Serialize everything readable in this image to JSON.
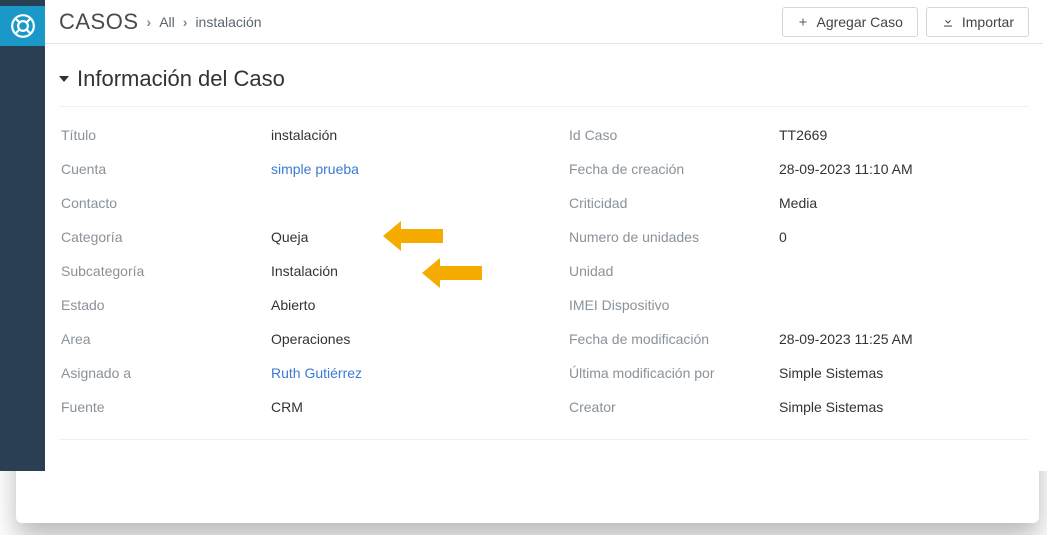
{
  "breadcrumb": {
    "module": "CASOS",
    "all": "All",
    "current": "instalación"
  },
  "header": {
    "add_case": "Agregar Caso",
    "import": "Importar"
  },
  "panel": {
    "title": "Información del Caso"
  },
  "left": {
    "titulo_label": "Título",
    "titulo": "instalación",
    "cuenta_label": "Cuenta",
    "cuenta": "simple prueba",
    "contacto_label": "Contacto",
    "contacto": "",
    "categoria_label": "Categoría",
    "categoria": "Queja",
    "subcategoria_label": "Subcategoría",
    "subcategoria": "Instalación",
    "estado_label": "Estado",
    "estado": "Abierto",
    "area_label": "Area",
    "area": "Operaciones",
    "asignado_label": "Asignado a",
    "asignado": "Ruth Gutiérrez",
    "fuente_label": "Fuente",
    "fuente": "CRM"
  },
  "right": {
    "idcaso_label": "Id Caso",
    "idcaso": "TT2669",
    "fcreacion_label": "Fecha de creación",
    "fcreacion": "28-09-2023 11:10 AM",
    "criticidad_label": "Criticidad",
    "criticidad": "Media",
    "nunidades_label": "Numero de unidades",
    "nunidades": "0",
    "unidad_label": "Unidad",
    "unidad": "",
    "imei_label": "IMEI Dispositivo",
    "imei": "",
    "fmod_label": "Fecha de modificación",
    "fmod": "28-09-2023 11:25 AM",
    "ultmod_label": "Última modificación por",
    "ultmod": "Simple Sistemas",
    "creator_label": "Creator",
    "creator": "Simple Sistemas"
  }
}
